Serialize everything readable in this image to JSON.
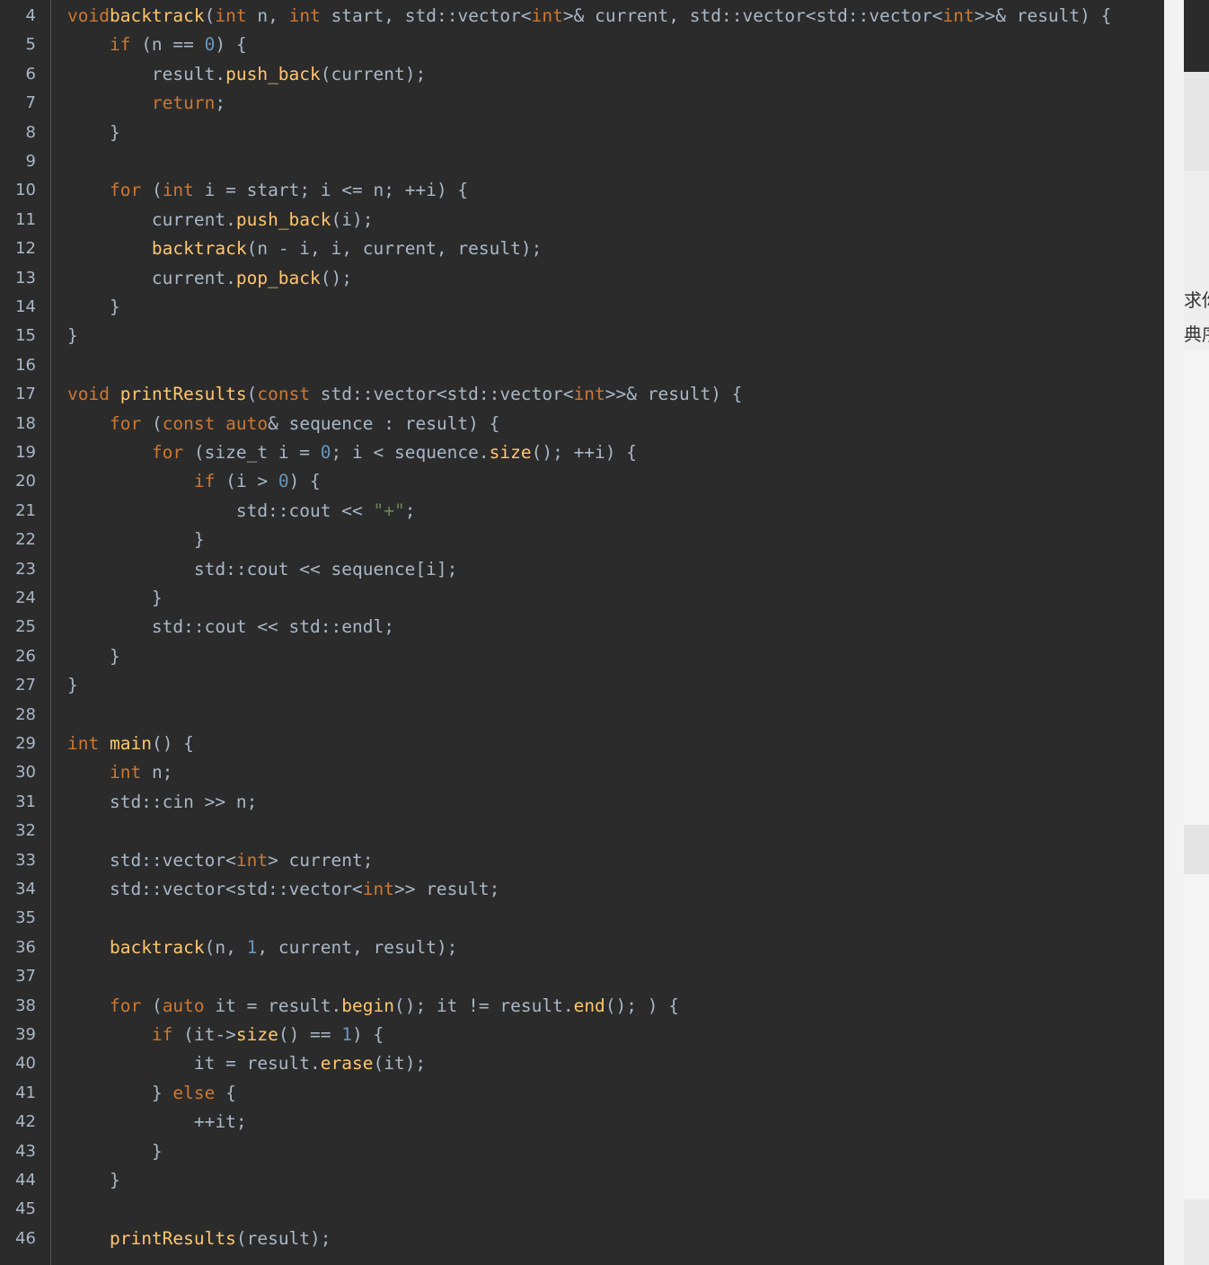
{
  "editor": {
    "lines": [
      {
        "n": "4",
        "tokens": [
          [
            "kw",
            "void"
          ],
          [
            "",
            ""
          ],
          [
            "fn",
            "backtrack"
          ],
          [
            "",
            "("
          ],
          [
            "kw",
            "int"
          ],
          [
            "",
            " n, "
          ],
          [
            "kw",
            "int"
          ],
          [
            "",
            " start, std::vector<"
          ],
          [
            "kw",
            "int"
          ],
          [
            "",
            ">& current, std::vector<std::vector<"
          ],
          [
            "kw",
            "int"
          ],
          [
            "",
            ">>& result) {"
          ]
        ]
      },
      {
        "n": "5",
        "tokens": [
          [
            "",
            "    "
          ],
          [
            "kw",
            "if"
          ],
          [
            "",
            " (n == "
          ],
          [
            "num",
            "0"
          ],
          [
            "",
            ") {"
          ]
        ]
      },
      {
        "n": "6",
        "tokens": [
          [
            "",
            "        result."
          ],
          [
            "fn",
            "push_back"
          ],
          [
            "",
            "(current);"
          ]
        ]
      },
      {
        "n": "7",
        "tokens": [
          [
            "",
            "        "
          ],
          [
            "kw",
            "return"
          ],
          [
            "",
            ";"
          ]
        ]
      },
      {
        "n": "8",
        "tokens": [
          [
            "",
            "    }"
          ]
        ]
      },
      {
        "n": "9",
        "tokens": []
      },
      {
        "n": "10",
        "tokens": [
          [
            "",
            "    "
          ],
          [
            "kw",
            "for"
          ],
          [
            "",
            " ("
          ],
          [
            "kw",
            "int"
          ],
          [
            "",
            " i = start; i <= n; ++i) {"
          ]
        ]
      },
      {
        "n": "11",
        "tokens": [
          [
            "",
            "        current."
          ],
          [
            "fn",
            "push_back"
          ],
          [
            "",
            "(i);"
          ]
        ]
      },
      {
        "n": "12",
        "tokens": [
          [
            "",
            "        "
          ],
          [
            "fn",
            "backtrack"
          ],
          [
            "",
            "(n - i, i, current, result);"
          ]
        ]
      },
      {
        "n": "13",
        "tokens": [
          [
            "",
            "        current."
          ],
          [
            "fn",
            "pop_back"
          ],
          [
            "",
            "();"
          ]
        ]
      },
      {
        "n": "14",
        "tokens": [
          [
            "",
            "    }"
          ]
        ]
      },
      {
        "n": "15",
        "tokens": [
          [
            "",
            "}"
          ]
        ]
      },
      {
        "n": "16",
        "tokens": []
      },
      {
        "n": "17",
        "tokens": [
          [
            "kw",
            "void"
          ],
          [
            "",
            " "
          ],
          [
            "fn",
            "printResults"
          ],
          [
            "",
            "("
          ],
          [
            "kw",
            "const"
          ],
          [
            "",
            " std::vector<std::vector<"
          ],
          [
            "kw",
            "int"
          ],
          [
            "",
            ">>& result) {"
          ]
        ]
      },
      {
        "n": "18",
        "tokens": [
          [
            "",
            "    "
          ],
          [
            "kw",
            "for"
          ],
          [
            "",
            " ("
          ],
          [
            "kw",
            "const"
          ],
          [
            "",
            " "
          ],
          [
            "kw",
            "auto"
          ],
          [
            "",
            "& sequence : result) {"
          ]
        ]
      },
      {
        "n": "19",
        "tokens": [
          [
            "",
            "        "
          ],
          [
            "kw",
            "for"
          ],
          [
            "",
            " (size_t i = "
          ],
          [
            "num",
            "0"
          ],
          [
            "",
            "; i < sequence."
          ],
          [
            "fn",
            "size"
          ],
          [
            "",
            "(); ++i) {"
          ]
        ]
      },
      {
        "n": "20",
        "tokens": [
          [
            "",
            "            "
          ],
          [
            "kw",
            "if"
          ],
          [
            "",
            " (i > "
          ],
          [
            "num",
            "0"
          ],
          [
            "",
            ") {"
          ]
        ]
      },
      {
        "n": "21",
        "tokens": [
          [
            "",
            "                std::cout << "
          ],
          [
            "str",
            "\"+\""
          ],
          [
            "",
            ";"
          ]
        ]
      },
      {
        "n": "22",
        "tokens": [
          [
            "",
            "            }"
          ]
        ]
      },
      {
        "n": "23",
        "tokens": [
          [
            "",
            "            std::cout << sequence[i];"
          ]
        ]
      },
      {
        "n": "24",
        "tokens": [
          [
            "",
            "        }"
          ]
        ]
      },
      {
        "n": "25",
        "tokens": [
          [
            "",
            "        std::cout << std::endl;"
          ]
        ]
      },
      {
        "n": "26",
        "tokens": [
          [
            "",
            "    }"
          ]
        ]
      },
      {
        "n": "27",
        "tokens": [
          [
            "",
            "}"
          ]
        ]
      },
      {
        "n": "28",
        "tokens": []
      },
      {
        "n": "29",
        "tokens": [
          [
            "kw",
            "int"
          ],
          [
            "",
            " "
          ],
          [
            "fn",
            "main"
          ],
          [
            "",
            "() {"
          ]
        ]
      },
      {
        "n": "30",
        "tokens": [
          [
            "",
            "    "
          ],
          [
            "kw",
            "int"
          ],
          [
            "",
            " n;"
          ]
        ]
      },
      {
        "n": "31",
        "tokens": [
          [
            "",
            "    std::cin >> n;"
          ]
        ]
      },
      {
        "n": "32",
        "tokens": []
      },
      {
        "n": "33",
        "tokens": [
          [
            "",
            "    std::vector<"
          ],
          [
            "kw",
            "int"
          ],
          [
            "",
            "> current;"
          ]
        ]
      },
      {
        "n": "34",
        "tokens": [
          [
            "",
            "    std::vector<std::vector<"
          ],
          [
            "kw",
            "int"
          ],
          [
            "",
            ">> result;"
          ]
        ]
      },
      {
        "n": "35",
        "tokens": []
      },
      {
        "n": "36",
        "tokens": [
          [
            "",
            "    "
          ],
          [
            "fn",
            "backtrack"
          ],
          [
            "",
            "(n, "
          ],
          [
            "num",
            "1"
          ],
          [
            "",
            ", current, result);"
          ]
        ]
      },
      {
        "n": "37",
        "tokens": []
      },
      {
        "n": "38",
        "tokens": [
          [
            "",
            "    "
          ],
          [
            "kw",
            "for"
          ],
          [
            "",
            " ("
          ],
          [
            "kw",
            "auto"
          ],
          [
            "",
            " it = result."
          ],
          [
            "fn",
            "begin"
          ],
          [
            "",
            "(); it != result."
          ],
          [
            "fn",
            "end"
          ],
          [
            "",
            "(); ) {"
          ]
        ]
      },
      {
        "n": "39",
        "tokens": [
          [
            "",
            "        "
          ],
          [
            "kw",
            "if"
          ],
          [
            "",
            " (it->"
          ],
          [
            "fn",
            "size"
          ],
          [
            "",
            "() == "
          ],
          [
            "num",
            "1"
          ],
          [
            "",
            ") {"
          ]
        ]
      },
      {
        "n": "40",
        "tokens": [
          [
            "",
            "            it = result."
          ],
          [
            "fn",
            "erase"
          ],
          [
            "",
            "(it);"
          ]
        ]
      },
      {
        "n": "41",
        "tokens": [
          [
            "",
            "        } "
          ],
          [
            "kw",
            "else"
          ],
          [
            "",
            " {"
          ]
        ]
      },
      {
        "n": "42",
        "tokens": [
          [
            "",
            "            ++it;"
          ]
        ]
      },
      {
        "n": "43",
        "tokens": [
          [
            "",
            "        }"
          ]
        ]
      },
      {
        "n": "44",
        "tokens": [
          [
            "",
            "    }"
          ]
        ]
      },
      {
        "n": "45",
        "tokens": []
      },
      {
        "n": "46",
        "tokens": [
          [
            "",
            "    "
          ],
          [
            "fn",
            "printResults"
          ],
          [
            "",
            "(result);"
          ]
        ]
      }
    ]
  },
  "right_panel": {
    "snippets": [
      "求你",
      "典序"
    ]
  },
  "colors": {
    "background": "#2b2b2b",
    "keyword": "#cc7832",
    "function": "#ffc66d",
    "number": "#6897bb",
    "string": "#6a8759",
    "text": "#a9b7c6"
  }
}
